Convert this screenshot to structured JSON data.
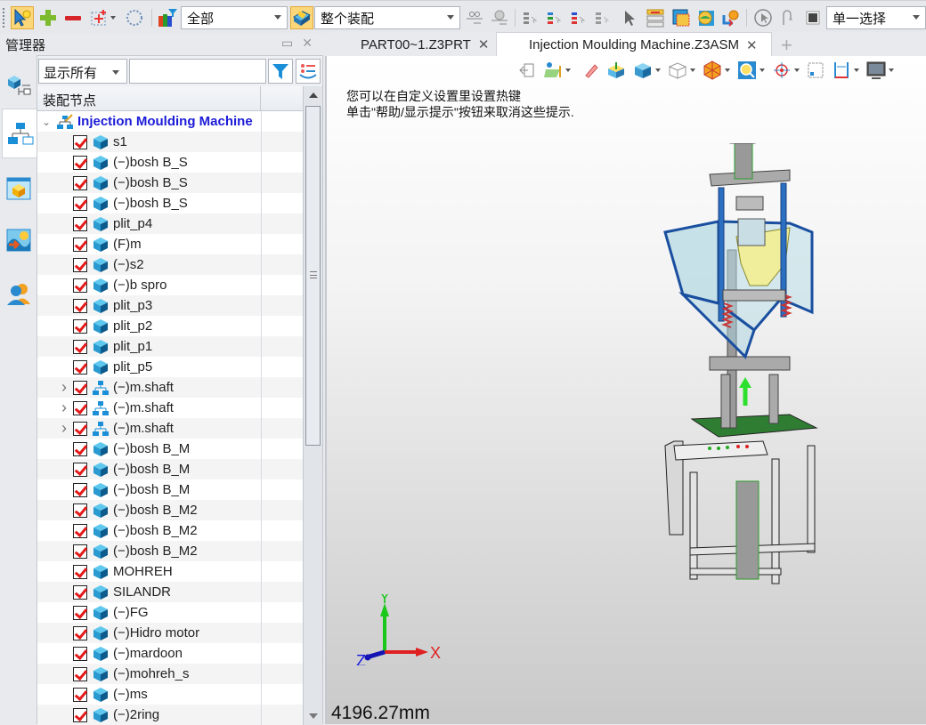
{
  "toolbar": {
    "items": [
      {
        "icon": "select-pick-icon",
        "active": true
      },
      {
        "icon": "add-icon"
      },
      {
        "icon": "remove-icon"
      },
      {
        "icon": "box-select-icon",
        "dropdown": true
      },
      {
        "icon": "circle-select-icon"
      },
      {
        "icon": "color-filter-icon"
      }
    ],
    "filter_combo": {
      "value": "全部"
    },
    "scope_icon": "assembly-scope-icon",
    "scope_combo": {
      "value": "整个装配"
    },
    "right_icons": [
      "ref-link-icon",
      "ref-time-icon",
      "list-select-1-icon",
      "list-select-2-icon",
      "list-select-3-icon",
      "list-select-4-icon",
      "pointer-icon",
      "layer-list-icon",
      "window-select-icon",
      "globe-select-icon",
      "settings-select-icon",
      "compass-icon",
      "hook-icon",
      "square-icon"
    ],
    "selection_combo": {
      "value": "单一选择"
    }
  },
  "manager": {
    "title": "管理器",
    "side_tabs": [
      "history-tree-icon",
      "assembly-tree-icon",
      "part-view-icon",
      "image-icon",
      "users-icon"
    ],
    "filter": {
      "value": "显示所有",
      "search_placeholder": ""
    },
    "column_header": "装配节点",
    "root": {
      "label": "Injection Moulding  Machine",
      "expanded": true
    },
    "items": [
      {
        "label": "s1",
        "type": "part",
        "checked": true
      },
      {
        "label": "(−)bosh B_S",
        "type": "part",
        "checked": true
      },
      {
        "label": "(−)bosh B_S",
        "type": "part",
        "checked": true
      },
      {
        "label": "(−)bosh B_S",
        "type": "part",
        "checked": true
      },
      {
        "label": "plit_p4",
        "type": "part",
        "checked": true
      },
      {
        "label": "(F)m",
        "type": "part",
        "checked": true
      },
      {
        "label": "(−)s2",
        "type": "part",
        "checked": true
      },
      {
        "label": "(−)b spro",
        "type": "part",
        "checked": true
      },
      {
        "label": "plit_p3",
        "type": "part",
        "checked": true
      },
      {
        "label": "plit_p2",
        "type": "part",
        "checked": true
      },
      {
        "label": "plit_p1",
        "type": "part",
        "checked": true
      },
      {
        "label": "plit_p5",
        "type": "part",
        "checked": true
      },
      {
        "label": "(−)m.shaft",
        "type": "assembly",
        "checked": true,
        "expandable": true
      },
      {
        "label": "(−)m.shaft",
        "type": "assembly",
        "checked": true,
        "expandable": true
      },
      {
        "label": "(−)m.shaft",
        "type": "assembly",
        "checked": true,
        "expandable": true
      },
      {
        "label": "(−)bosh B_M",
        "type": "part",
        "checked": true
      },
      {
        "label": "(−)bosh B_M",
        "type": "part",
        "checked": true
      },
      {
        "label": "(−)bosh B_M",
        "type": "part",
        "checked": true
      },
      {
        "label": "(−)bosh B_M2",
        "type": "part",
        "checked": true
      },
      {
        "label": "(−)bosh B_M2",
        "type": "part",
        "checked": true
      },
      {
        "label": "(−)bosh B_M2",
        "type": "part",
        "checked": true
      },
      {
        "label": "MOHREH",
        "type": "part",
        "checked": true
      },
      {
        "label": "SILANDR",
        "type": "part",
        "checked": true
      },
      {
        "label": "(−)FG",
        "type": "part",
        "checked": true
      },
      {
        "label": "(−)Hidro motor",
        "type": "part",
        "checked": true
      },
      {
        "label": "(−)mardoon",
        "type": "part",
        "checked": true
      },
      {
        "label": "(−)mohreh_s",
        "type": "part",
        "checked": true
      },
      {
        "label": "(−)ms",
        "type": "part",
        "checked": true
      },
      {
        "label": "(−)2ring",
        "type": "part",
        "checked": true
      }
    ]
  },
  "tabs": [
    {
      "label": "PART00~1.Z3PRT",
      "active": false
    },
    {
      "label": "Injection Moulding  Machine.Z3ASM",
      "active": true
    }
  ],
  "viewport": {
    "tools": [
      "exit-icon",
      "sketch-plane-icon",
      "eraser-icon",
      "normal-view-icon",
      "shaded-cube-icon",
      "wireframe-cube-icon",
      "render-mode-icon",
      "zoom-fit-icon",
      "rotate-center-icon",
      "view-frame-icon",
      "dimension-icon",
      "display-icon"
    ],
    "hints": [
      "您可以在自定义设置里设置热键",
      "单击\"帮助/显示提示\"按钮来取消这些提示."
    ],
    "measure": "4196.27mm",
    "axes": {
      "x": "X",
      "y": "Y",
      "z": "Z"
    }
  }
}
